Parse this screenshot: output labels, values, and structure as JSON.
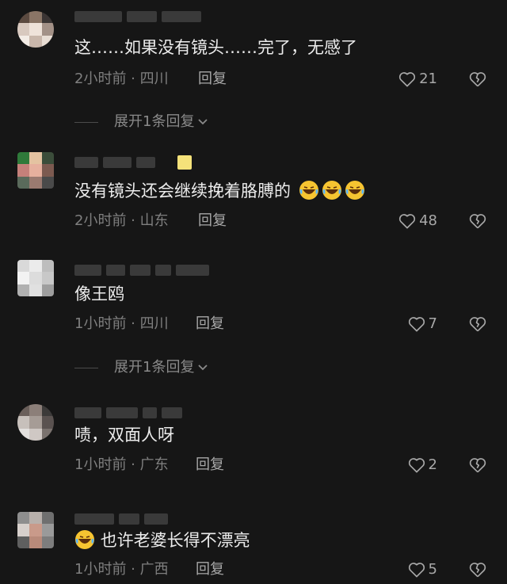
{
  "comments": [
    {
      "text": "这……如果没有镜头……完了，无感了",
      "time": "2小时前",
      "location": "四川",
      "reply_label": "回复",
      "likes": "21",
      "expand_label": "展开1条回复"
    },
    {
      "text": "没有镜头还会继续挽着胳膊的",
      "time": "2小时前",
      "location": "山东",
      "reply_label": "回复",
      "likes": "48"
    },
    {
      "text": "像王鸥",
      "time": "1小时前",
      "location": "四川",
      "reply_label": "回复",
      "likes": "7",
      "expand_label": "展开1条回复"
    },
    {
      "text": "啧，双面人呀",
      "time": "1小时前",
      "location": "广东",
      "reply_label": "回复",
      "likes": "2"
    },
    {
      "text": "也许老婆长得不漂亮",
      "time": "1小时前",
      "location": "广西",
      "reply_label": "回复",
      "likes": "5"
    }
  ],
  "icons": {
    "like": "heart-outline-icon",
    "dislike": "broken-heart-icon",
    "expand": "chevron-down-icon",
    "emoji": "rolling-on-floor-laughing-emoji"
  },
  "colors": {
    "background": "#161616",
    "text": "#ececec",
    "meta": "#7f7f7f"
  }
}
